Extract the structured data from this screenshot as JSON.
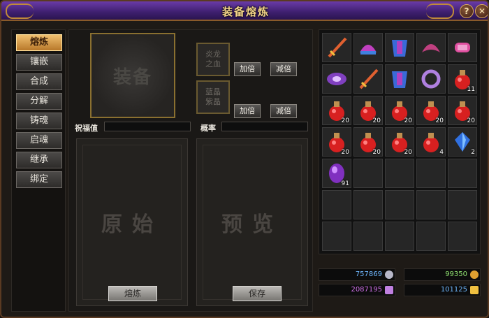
{
  "window": {
    "title": "装备熔炼"
  },
  "tabs": [
    {
      "label": "熔炼",
      "active": true
    },
    {
      "label": "镶嵌",
      "active": false
    },
    {
      "label": "合成",
      "active": false
    },
    {
      "label": "分解",
      "active": false
    },
    {
      "label": "铸魂",
      "active": false
    },
    {
      "label": "启魂",
      "active": false
    },
    {
      "label": "继承",
      "active": false
    },
    {
      "label": "绑定",
      "active": false
    }
  ],
  "forge": {
    "equip_slot_label": "装备",
    "material1": "炎龙\n之血",
    "material2": "蓝晶\n紫晶",
    "double_label": "加倍",
    "halve_label": "减倍",
    "bless_label": "祝福值",
    "rate_label": "概率",
    "original_label": "原始",
    "preview_label": "预览",
    "smelt_button": "熔炼",
    "save_button": "保存"
  },
  "inventory": [
    {
      "icon": "sword-icon",
      "count": ""
    },
    {
      "icon": "helmet-icon",
      "count": ""
    },
    {
      "icon": "armor-icon",
      "count": ""
    },
    {
      "icon": "shoulder-icon",
      "count": ""
    },
    {
      "icon": "bracer-icon",
      "count": ""
    },
    {
      "icon": "belt-icon",
      "count": ""
    },
    {
      "icon": "sword-icon",
      "count": ""
    },
    {
      "icon": "armor-icon",
      "count": ""
    },
    {
      "icon": "ring-icon",
      "count": ""
    },
    {
      "icon": "potion-icon",
      "count": "11"
    },
    {
      "icon": "potion-icon",
      "count": "20"
    },
    {
      "icon": "potion-icon",
      "count": "20"
    },
    {
      "icon": "potion-icon",
      "count": "20"
    },
    {
      "icon": "potion-icon",
      "count": "20"
    },
    {
      "icon": "potion-icon",
      "count": "20"
    },
    {
      "icon": "potion-icon",
      "count": "20"
    },
    {
      "icon": "potion-icon",
      "count": "20"
    },
    {
      "icon": "potion-icon",
      "count": "20"
    },
    {
      "icon": "potion-icon",
      "count": "4"
    },
    {
      "icon": "blue-gem-icon",
      "count": "2"
    },
    {
      "icon": "purple-gem-icon",
      "count": "91"
    }
  ],
  "currency": {
    "silver": "757869",
    "gold": "99350",
    "crystal": "2087195",
    "ingot": "101125",
    "colors": {
      "silver": "#6fb8ff",
      "gold": "#8fe070",
      "crystal": "#d070e8",
      "ingot": "#6fb8ff"
    }
  }
}
